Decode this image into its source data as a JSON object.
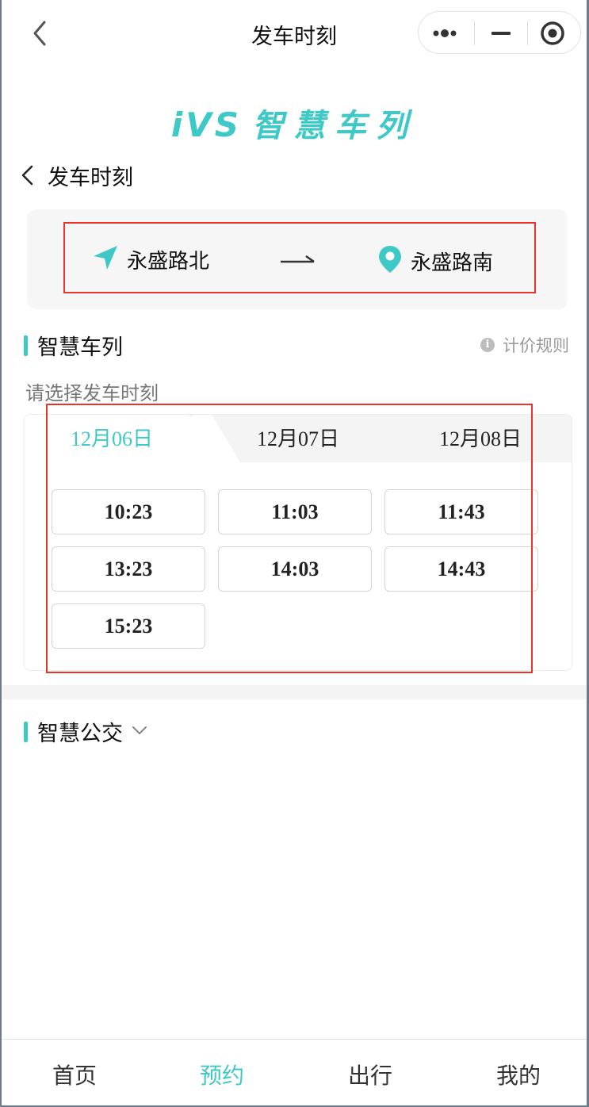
{
  "navbar": {
    "title": "发车时刻"
  },
  "brand": {
    "logo": "iVS",
    "name": "智慧车列"
  },
  "subheader": {
    "title": "发车时刻"
  },
  "route": {
    "from": "永盛路北",
    "to": "永盛路南"
  },
  "section_train": {
    "title": "智慧车列",
    "pricing_label": "计价规则",
    "hint": "请选择发车时刻"
  },
  "schedule": {
    "tabs": [
      {
        "label": "12月06日",
        "active": true
      },
      {
        "label": "12月07日",
        "active": false
      },
      {
        "label": "12月08日",
        "active": false
      }
    ],
    "times": [
      "10:23",
      "11:03",
      "11:43",
      "13:23",
      "14:03",
      "14:43",
      "15:23"
    ]
  },
  "section_bus": {
    "title": "智慧公交"
  },
  "tabbar": {
    "items": [
      {
        "label": "首页",
        "active": false
      },
      {
        "label": "预约",
        "active": true
      },
      {
        "label": "出行",
        "active": false
      },
      {
        "label": "我的",
        "active": false
      }
    ]
  },
  "colors": {
    "accent": "#3ec9c6",
    "highlight_box": "#e8352b"
  },
  "icons": [
    "back-icon",
    "more-dots-icon",
    "minimize-icon",
    "close-target-icon",
    "navigation-arrow-icon",
    "location-pin-icon",
    "arrow-right-icon",
    "info-icon",
    "chevron-down-icon"
  ]
}
